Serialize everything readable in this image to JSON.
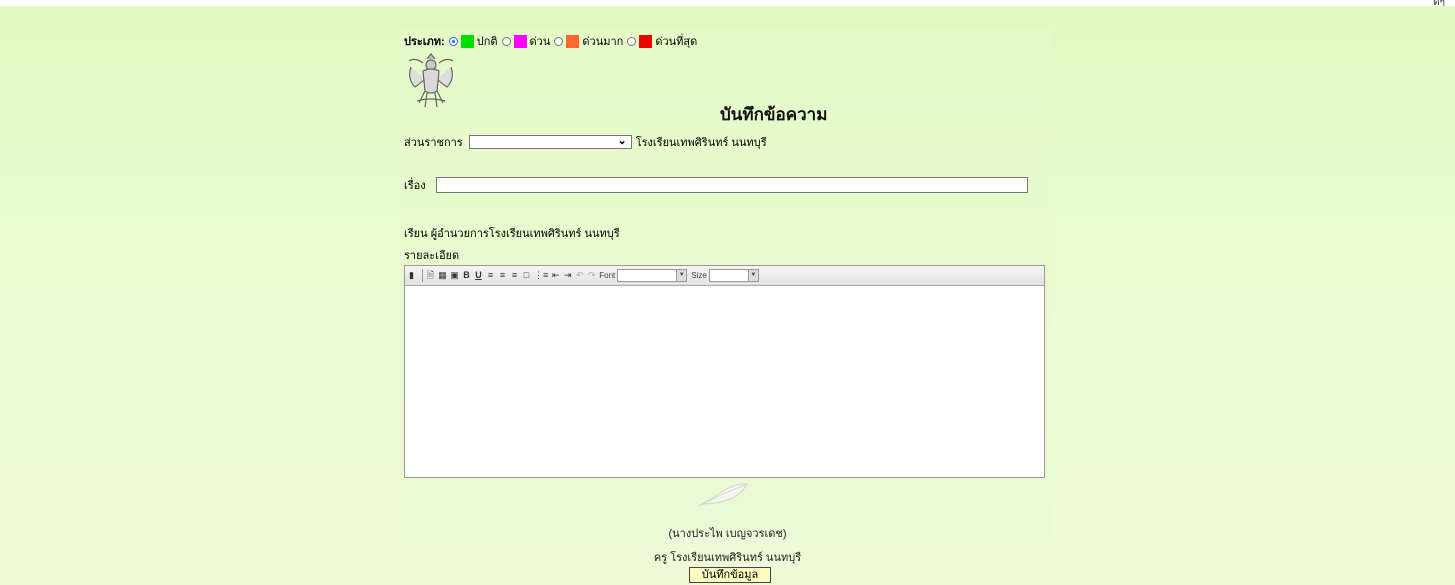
{
  "top_fragment": "ฺ ดีๆ",
  "type_selector": {
    "label": "ประเภท:",
    "options": [
      {
        "label": "ปกติ",
        "color": "#00e000",
        "selected": true
      },
      {
        "label": "ด่วน",
        "color": "#ff00ff",
        "selected": false
      },
      {
        "label": "ด่วนมาก",
        "color": "#ff6633",
        "selected": false
      },
      {
        "label": "ด่วนที่สุด",
        "color": "#ee0000",
        "selected": false
      }
    ]
  },
  "title": "บันทึกข้อความ",
  "department": {
    "label": "ส่วนราชการ",
    "selected": "",
    "school": "โรงเรียนเทพศิรินทร์ นนทบุรี"
  },
  "subject": {
    "label": "เรื่อง",
    "value": ""
  },
  "to_line": "เรียน  ผู้อำนวยการโรงเรียนเทพศิรินทร์ นนทบุรี",
  "detail_label": "รายละเอียด",
  "editor": {
    "font_label": "Font",
    "size_label": "Size",
    "font_value": "",
    "size_value": "",
    "content": ""
  },
  "signature": {
    "name": "(นางประไพ เบญจวรเดช)",
    "position": "ครู โรงเรียนเทพศิรินทร์ นนทบุรี"
  },
  "save_button": "บันทึกข้อมูล"
}
